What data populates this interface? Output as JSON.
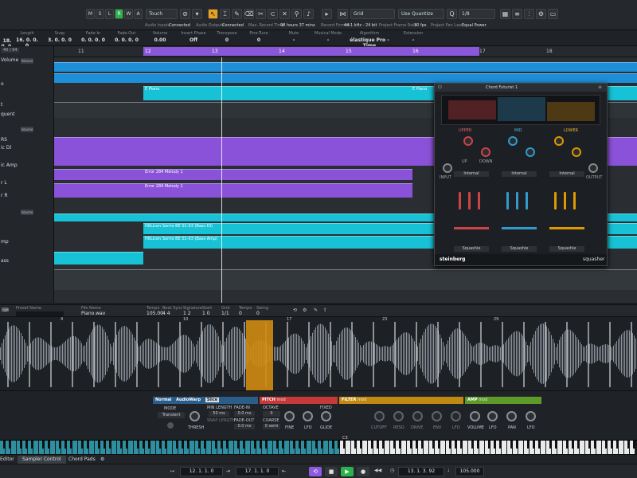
{
  "toolbar": {
    "mode_buttons": [
      "M",
      "S",
      "L",
      "R",
      "W",
      "A"
    ],
    "automation_mode": "Touch",
    "snap_type": "Grid",
    "quantize": "Use Quantize",
    "quantize_value": "1/8"
  },
  "status_line": {
    "labels": [
      "Audio Inputs",
      "Audio Outputs",
      "Max. Record Time",
      "Record Format",
      "Project Frame Rate",
      "Project Pan Law"
    ],
    "values": [
      "Connected",
      "Connected",
      "98 hours 37 mins",
      "44.1 kHz - 24 bit",
      "30 fps",
      "Equal Power"
    ]
  },
  "info_line": {
    "columns": [
      {
        "label": "Length",
        "value": "16. 0. 0. 0"
      },
      {
        "label": "Snap",
        "value": "3. 0. 0. 0"
      },
      {
        "label": "Fade-In",
        "value": "0. 0. 0. 0"
      },
      {
        "label": "Fade-Out",
        "value": "0. 0. 0. 0"
      },
      {
        "label": "Volume",
        "value": "0.00"
      },
      {
        "label": "Invert Phase",
        "value": "Off"
      },
      {
        "label": "Transpose",
        "value": "0"
      },
      {
        "label": "Fine-Tune",
        "value": "0"
      },
      {
        "label": "Mute",
        "value": "-"
      },
      {
        "label": "Musical Mode",
        "value": "-"
      },
      {
        "label": "Algorithm",
        "value": "élastique Pro - Time"
      },
      {
        "label": "Extension",
        "value": "-"
      }
    ],
    "left_value": "18. 0. 0. 0",
    "counter": "40 / 94"
  },
  "ruler": {
    "bars": [
      "11",
      "12",
      "13",
      "14",
      "15",
      "16",
      "17",
      "18"
    ]
  },
  "tracks": [
    {
      "name": "Volume",
      "tag": "Volume"
    },
    {
      "name": "",
      "tag": ""
    },
    {
      "name": "o",
      "tag": ""
    },
    {
      "name": "",
      "tag": ""
    },
    {
      "name": "t",
      "tag": ""
    },
    {
      "name": "quent",
      "tag": ""
    },
    {
      "name": "",
      "tag": "Volume"
    },
    {
      "name": "RS",
      "tag": ""
    },
    {
      "name": "ic Dl",
      "tag": ""
    },
    {
      "name": "",
      "tag": ""
    },
    {
      "name": "ic Amp",
      "tag": ""
    },
    {
      "name": "",
      "tag": ""
    },
    {
      "name": "r L",
      "tag": ""
    },
    {
      "name": "",
      "tag": ""
    },
    {
      "name": "r R",
      "tag": ""
    },
    {
      "name": "",
      "tag": ""
    },
    {
      "name": "",
      "tag": "Volume"
    },
    {
      "name": "",
      "tag": ""
    },
    {
      "name": "",
      "tag": ""
    },
    {
      "name": "mp",
      "tag": ""
    },
    {
      "name": "",
      "tag": ""
    },
    {
      "name": "ass",
      "tag": ""
    }
  ],
  "clips": {
    "piano1": "E Piano",
    "piano2": "E Piano",
    "melody1": "Error 284 Melody 1",
    "melody2": "Error 284 Melody 1",
    "bass_di": "HitLicen Sorrio BE 01-03 (Bass DI)",
    "bass_amp": "HitLicen Sorrio BE 01-03 (Bass Amp)"
  },
  "plugin": {
    "preset": "Chord Futurist 1",
    "brand": "steinberg",
    "product": "squasher",
    "bands": [
      "UPPER",
      "MID",
      "LOWER"
    ],
    "knob_labels": [
      "IN",
      "OUT",
      "UP",
      "DOWN"
    ],
    "io_labels": [
      "INPUT",
      "OUTPUT"
    ],
    "routing": [
      "Internal",
      "Internal",
      "Internal"
    ],
    "mode_labels": [
      "Squashie",
      "Squashie",
      "Squashie"
    ]
  },
  "sampler": {
    "preset_label": "Preset Name",
    "file_label": "File Name",
    "file_name": "Piano.wav",
    "fields": [
      {
        "label": "Tempo",
        "value": "105.00"
      },
      {
        "label": "Beat Sync",
        "value": "4 4"
      },
      {
        "label": "Signature",
        "value": "1 2"
      },
      {
        "label": "Start",
        "value": "1 0"
      },
      {
        "label": "Grid",
        "value": "1/1"
      },
      {
        "label": "Tempo",
        "value": "0"
      },
      {
        "label": "Swing",
        "value": "0"
      }
    ],
    "ruler_marks": [
      "4",
      "10",
      "17",
      "23",
      "29"
    ]
  },
  "controls": {
    "tabs": [
      "Normal",
      "AudioWarp",
      "Slice"
    ],
    "slice": {
      "mode_label": "MODE",
      "mode": "Transient",
      "thresh": "THRESH",
      "min_length_label": "MIN LENGTH",
      "min_length": "50 ms",
      "fade_in_label": "FADE-IN",
      "fade_in": "0.0 ms",
      "fade_out_label": "FADE-OUT",
      "fade_out": "0.0 ms",
      "snap_label": "SNAP LENGTH"
    },
    "pitch": {
      "title": "PITCH",
      "mod": "mod",
      "octave_label": "OCTAVE",
      "octave": "0",
      "coarse_label": "COARSE",
      "coarse": "0 semi",
      "knobs": [
        "FINE",
        "LFO",
        "GLIDE"
      ],
      "fixed": "FIXED"
    },
    "filter": {
      "title": "FILTER",
      "mod": "mod",
      "knobs": [
        "CUTOFF",
        "RESO",
        "DRIVE",
        "ENV",
        "LFO"
      ]
    },
    "amp": {
      "title": "AMP",
      "mod": "mod",
      "knobs": [
        "VOLUME",
        "LFO",
        "PAN",
        "LFO"
      ]
    }
  },
  "keyboard": {
    "c_label": "C3"
  },
  "bottom_tabs": [
    "Editor",
    "Sampler Control",
    "Chord Pads"
  ],
  "transport": {
    "left_locator": "12. 1. 1. 0",
    "right_locator": "17. 1. 1. 0",
    "position": "13. 1. 3. 92",
    "tempo": "105.000"
  },
  "colors": {
    "accent": "#8e5ae0",
    "cyan": "#17c2d6",
    "blue": "#1d8fd8",
    "purple": "#8a52d8",
    "orange": "#d08a12"
  }
}
